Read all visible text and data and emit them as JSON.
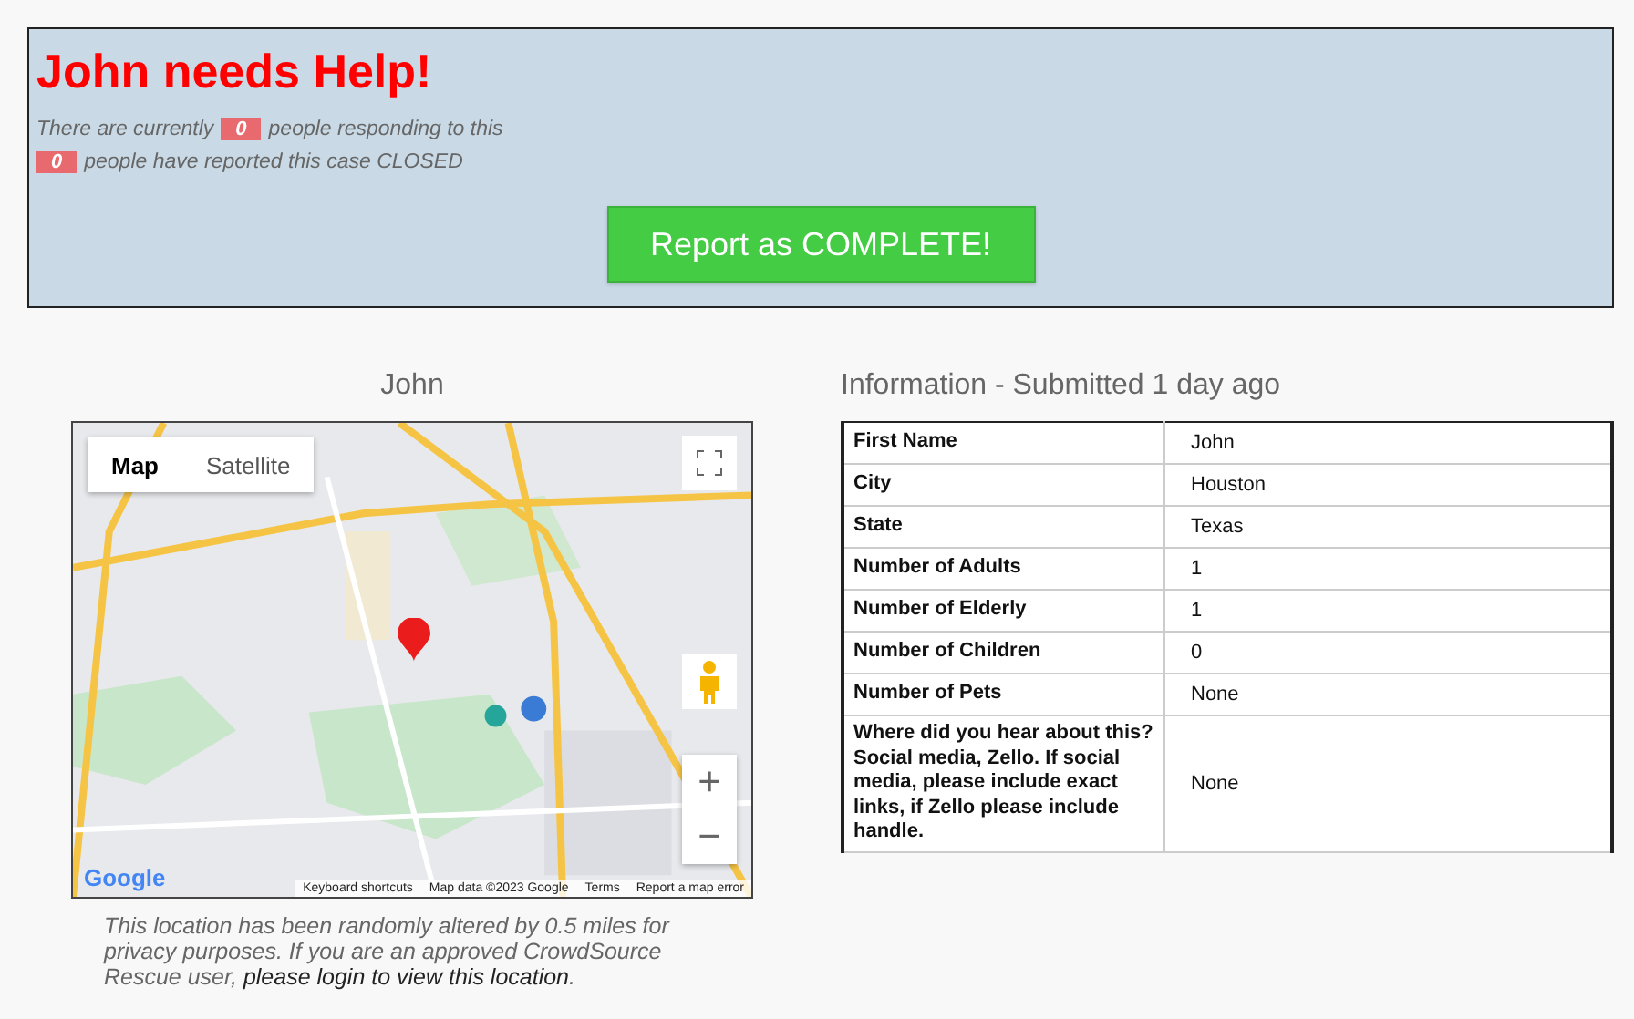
{
  "alert": {
    "title": "John needs Help!",
    "responding_prefix": "There are currently",
    "responding_count": "0",
    "responding_suffix": "people responding to this",
    "closed_count": "0",
    "closed_suffix": "people have reported this case CLOSED",
    "button": "Report as COMPLETE!"
  },
  "map_panel": {
    "title": "John",
    "map": {
      "kind": "picture",
      "map_types": [
        {
          "label": "Map",
          "selected": true
        },
        {
          "label": "Satellite",
          "selected": false
        }
      ],
      "zoom_in": "+",
      "zoom_out": "−",
      "logo": "Google",
      "footer": [
        "Keyboard shortcuts",
        "Map data ©2023 Google",
        "Terms",
        "Report a map error"
      ]
    },
    "note": "This location has been randomly altered by 0.5 miles for privacy purposes. If you are an approved CrowdSource Rescue user,",
    "note_link": "please login to view this location",
    "note_end": "."
  },
  "info": {
    "title": "Information - Submitted 1 day ago",
    "rows": [
      {
        "label": "First Name",
        "value": "John"
      },
      {
        "label": "City",
        "value": "Houston"
      },
      {
        "label": "State",
        "value": "Texas"
      },
      {
        "label": "Number of Adults",
        "value": "1"
      },
      {
        "label": "Number of Elderly",
        "value": "1"
      },
      {
        "label": "Number of Children",
        "value": "0"
      },
      {
        "label": "Number of Pets",
        "value": "None"
      },
      {
        "label": "Where did you hear about this? Social media, Zello. If social media, please include exact links, if Zello please include handle.",
        "value": "None"
      }
    ]
  }
}
